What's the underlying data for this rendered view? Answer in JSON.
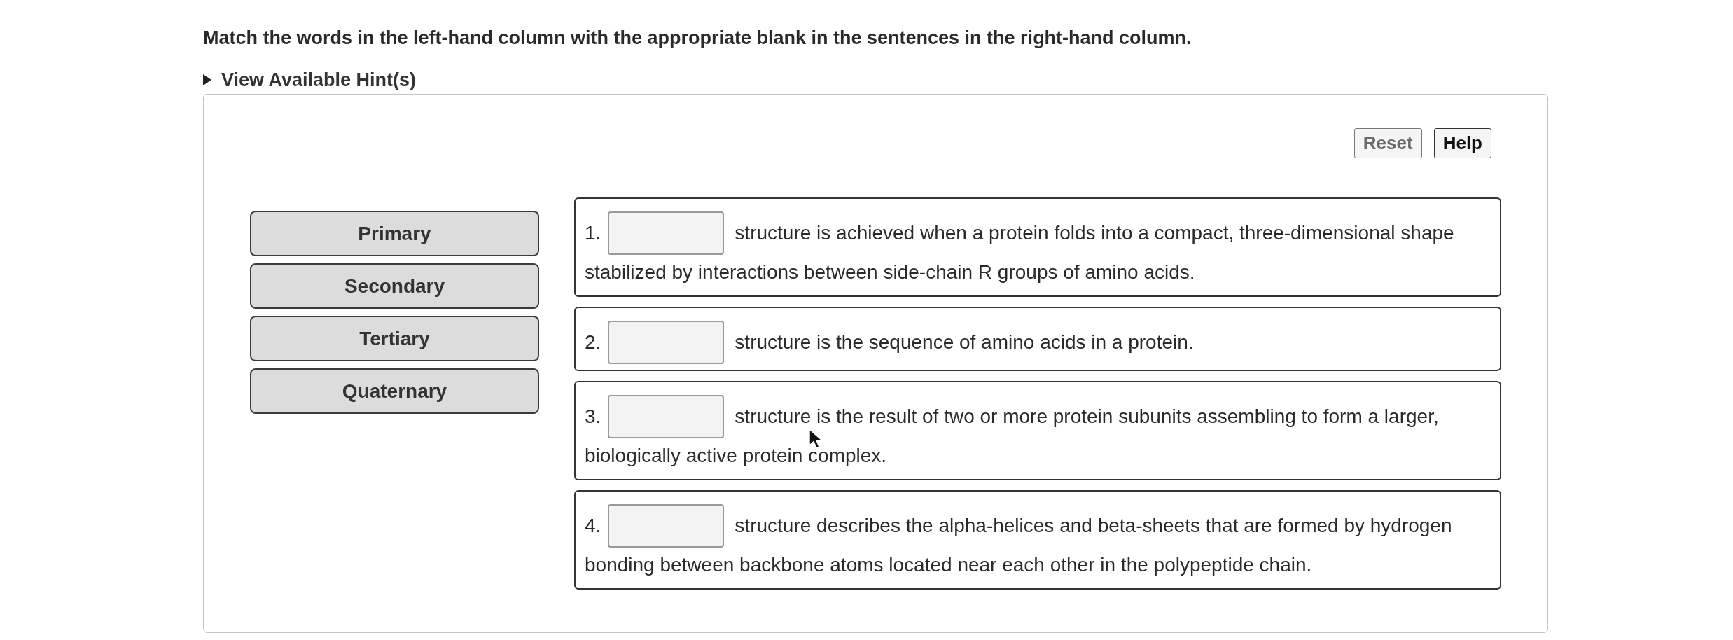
{
  "instructions": "Match the words in the left-hand column with the appropriate blank in the sentences in the right-hand column.",
  "hints": {
    "label": "View Available Hint(s)",
    "expanded": false
  },
  "buttons": [
    {
      "label": "Reset",
      "disabled": true
    },
    {
      "label": "Help",
      "disabled": false
    }
  ],
  "word_bank": [
    "Primary",
    "Secondary",
    "Tertiary",
    "Quaternary"
  ],
  "sentences": [
    {
      "number": "1.",
      "lines": [
        "structure is achieved when a protein folds into a compact, three-dimensional shape",
        "stabilized by interactions between side-chain R groups of amino acids."
      ]
    },
    {
      "number": "2.",
      "lines": [
        "structure is the sequence of amino acids in a protein."
      ]
    },
    {
      "number": "3.",
      "lines": [
        "structure is the result of two or more protein subunits assembling to form a larger,",
        "biologically active protein complex."
      ]
    },
    {
      "number": "4.",
      "lines": [
        "structure describes the alpha-helices and beta-sheets that are formed by hydrogen",
        "bonding between backbone atoms located near each other in the polypeptide chain."
      ]
    }
  ]
}
